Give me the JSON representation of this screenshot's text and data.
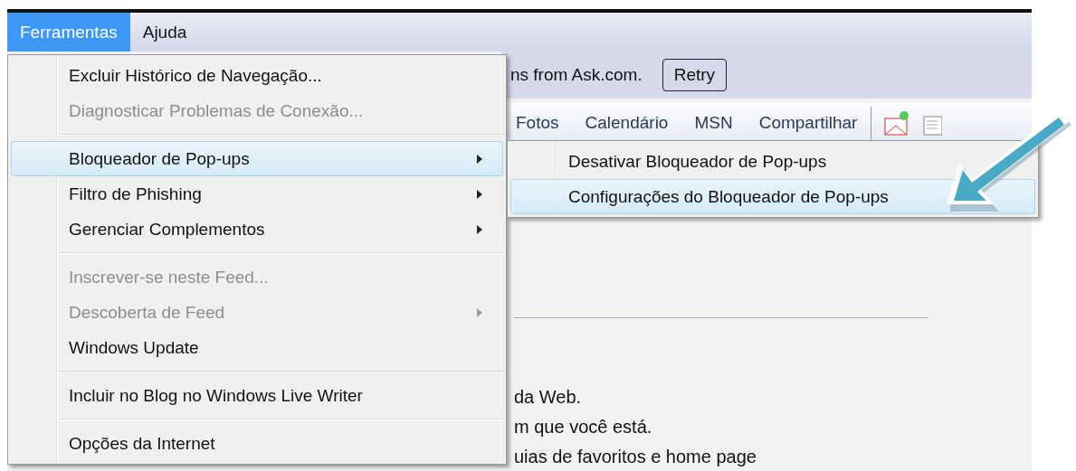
{
  "menubar": [
    {
      "label": "Ferramentas",
      "selected": true
    },
    {
      "label": "Ajuda",
      "selected": false
    }
  ],
  "info_bar": {
    "text": "ns from Ask.com.",
    "button": "Retry"
  },
  "toolbar": {
    "links": [
      "Fotos",
      "Calendário",
      "MSN",
      "Compartilhar"
    ]
  },
  "body_lines": [
    "da Web.",
    "m que você está.",
    "uias de favoritos e home page"
  ],
  "menu": {
    "items": [
      {
        "kind": "item",
        "label": "Excluir Histórico de Navegação...",
        "disabled": false,
        "submenu": false,
        "selected": false
      },
      {
        "kind": "item",
        "label": "Diagnosticar Problemas de Conexão...",
        "disabled": true,
        "submenu": false,
        "selected": false
      },
      {
        "kind": "separator"
      },
      {
        "kind": "item",
        "label": "Bloqueador de Pop-ups",
        "disabled": false,
        "submenu": true,
        "selected": true
      },
      {
        "kind": "item",
        "label": "Filtro de Phishing",
        "disabled": false,
        "submenu": true,
        "selected": false
      },
      {
        "kind": "item",
        "label": "Gerenciar Complementos",
        "disabled": false,
        "submenu": true,
        "selected": false
      },
      {
        "kind": "separator"
      },
      {
        "kind": "item",
        "label": "Inscrever-se neste Feed...",
        "disabled": true,
        "submenu": false,
        "selected": false
      },
      {
        "kind": "item",
        "label": "Descoberta de Feed",
        "disabled": true,
        "submenu": true,
        "selected": false
      },
      {
        "kind": "item",
        "label": "Windows Update",
        "disabled": false,
        "submenu": false,
        "selected": false
      },
      {
        "kind": "separator"
      },
      {
        "kind": "item",
        "label": "Incluir no Blog no Windows Live Writer",
        "disabled": false,
        "submenu": false,
        "selected": false
      },
      {
        "kind": "separator"
      },
      {
        "kind": "item",
        "label": "Opções da Internet",
        "disabled": false,
        "submenu": false,
        "selected": false
      }
    ]
  },
  "submenu": {
    "items": [
      {
        "label": "Desativar Bloqueador de Pop-ups",
        "selected": false
      },
      {
        "label": "Configurações do Bloqueador de Pop-ups",
        "selected": true
      }
    ]
  }
}
